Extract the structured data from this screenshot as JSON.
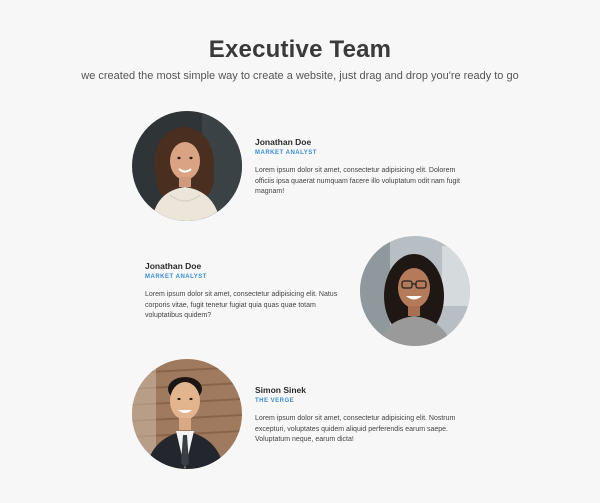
{
  "section": {
    "title": "Executive Team",
    "subtitle": "we created the most simple way to create a website, just drag and drop you're ready to go"
  },
  "members": [
    {
      "name": "Jonathan Doe",
      "role": "MARKET ANALYST",
      "bio": "Lorem ipsum dolor sit amet, consectetur adipisicing elit. Dolorem officiis ipsa quaerat numquam facere illo voluptatum odit nam fugit magnam!",
      "photo": "woman-curly-hair-portrait"
    },
    {
      "name": "Jonathan Doe",
      "role": "MARKET ANALYST",
      "bio": "Lorem ipsum dolor sit amet, consectetur adipisicing elit. Natus corporis vitae, fugit tenetur fugiat quia quas quae totam voluptatibus quidem?",
      "photo": "woman-glasses-portrait"
    },
    {
      "name": "Simon Sinek",
      "role": "THE VERGE",
      "bio": "Lorem ipsum dolor sit amet, consectetur adipisicing elit. Nostrum excepturi, voluptates quidem aliquid perferendis earum saepe. Voluptatum neque, earum dicta!",
      "photo": "man-suit-portrait"
    }
  ],
  "colors": {
    "background": "#f7f7f7",
    "accent": "#3a8dd6",
    "heading": "#3a3a3a"
  }
}
